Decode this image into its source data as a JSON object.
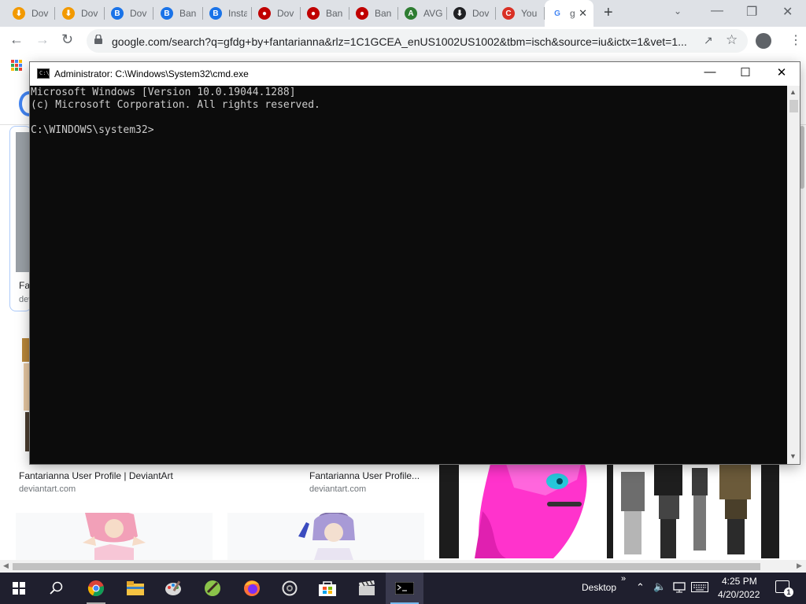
{
  "browser": {
    "tabs": [
      {
        "label": "Dov",
        "icon": "download-icon",
        "color": "#f29900"
      },
      {
        "label": "Dov",
        "icon": "download-icon",
        "color": "#f29900"
      },
      {
        "label": "Dov",
        "icon": "bitdefender-icon",
        "color": "#1a73e8"
      },
      {
        "label": "Ban",
        "icon": "bitdefender-icon",
        "color": "#1a73e8"
      },
      {
        "label": "Insta",
        "icon": "bitdefender-icon",
        "color": "#1a73e8"
      },
      {
        "label": "Dov",
        "icon": "record-icon",
        "color": "#c00000"
      },
      {
        "label": "Ban",
        "icon": "record-icon",
        "color": "#c00000"
      },
      {
        "label": "Ban",
        "icon": "record-icon",
        "color": "#c00000"
      },
      {
        "label": "AVG",
        "icon": "avg-icon",
        "color": "#2e7d32"
      },
      {
        "label": "Dov",
        "icon": "download-icon",
        "color": "#202124"
      },
      {
        "label": "You",
        "icon": "c-logo-icon",
        "color": "#d93025"
      },
      {
        "label": "g",
        "icon": "google-icon",
        "color": "#4285f4"
      }
    ],
    "url": "google.com/search?q=gfdg+by+fantarianna&rlz=1C1GCEA_enUS1002US1002&tbm=isch&source=iu&ictx=1&vet=1..."
  },
  "page": {
    "card1_title": "Fan",
    "card1_source": "dev",
    "results": [
      {
        "title": "Fantarianna User Profile | DeviantArt",
        "source": "deviantart.com"
      },
      {
        "title": "Fantarianna User Profile...",
        "source": "deviantart.com"
      }
    ]
  },
  "cmd": {
    "title": "Administrator: C:\\Windows\\System32\\cmd.exe",
    "icon_text": "C:\\",
    "lines": [
      "Microsoft Windows [Version 10.0.19044.1288]",
      "(c) Microsoft Corporation. All rights reserved.",
      "",
      "C:\\WINDOWS\\system32>"
    ]
  },
  "taskbar": {
    "apps": [
      "windows-start-icon",
      "search-icon",
      "chrome-icon",
      "file-explorer-icon",
      "paint-icon",
      "notepadpp-icon",
      "firefox-icon",
      "settings-icon",
      "store-icon",
      "clapper-icon",
      "cmd-icon"
    ],
    "desktop_label": "Desktop",
    "time": "4:25 PM",
    "date": "4/20/2022",
    "notification_count": "1"
  }
}
